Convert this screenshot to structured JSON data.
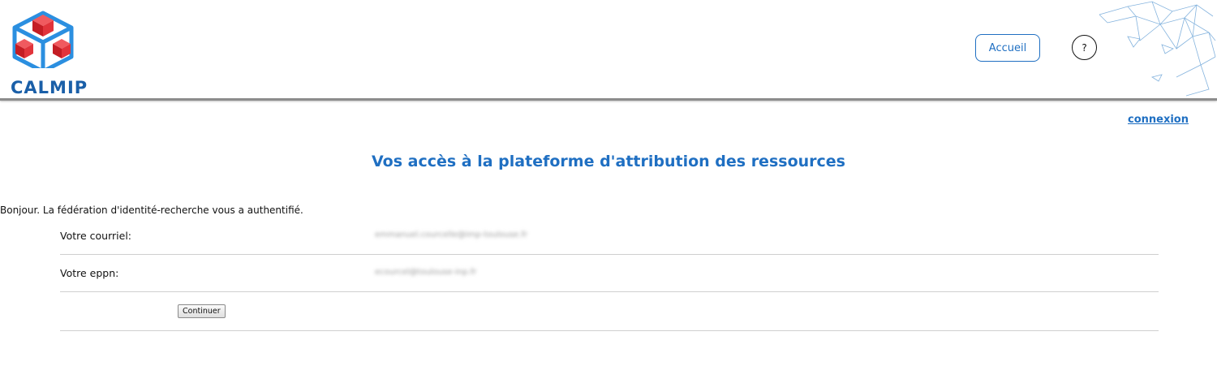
{
  "header": {
    "logo_text": "CALMIP",
    "home_button": "Accueil",
    "help_button": "?",
    "logo_icon": "calmip-cube-logo",
    "deco_icon": "network-triangles-decoration"
  },
  "auth": {
    "login_link": "connexion"
  },
  "main": {
    "title": "Vos accès à la plateforme d'attribution des ressources",
    "greeting": "Bonjour. La fédération d'identité-recherche vous a authentifié.",
    "rows": [
      {
        "label": "Votre courriel:",
        "value": "emmanuel.courcelle@imp-toulouse.fr"
      },
      {
        "label": "Votre eppn:",
        "value": "ecourcel@toulouse-inp.fr"
      }
    ],
    "continue_button": "Continuer"
  },
  "colors": {
    "accent": "#1f6fc2",
    "logo_blue": "#1a5fa8",
    "logo_red": "#d6232a"
  }
}
